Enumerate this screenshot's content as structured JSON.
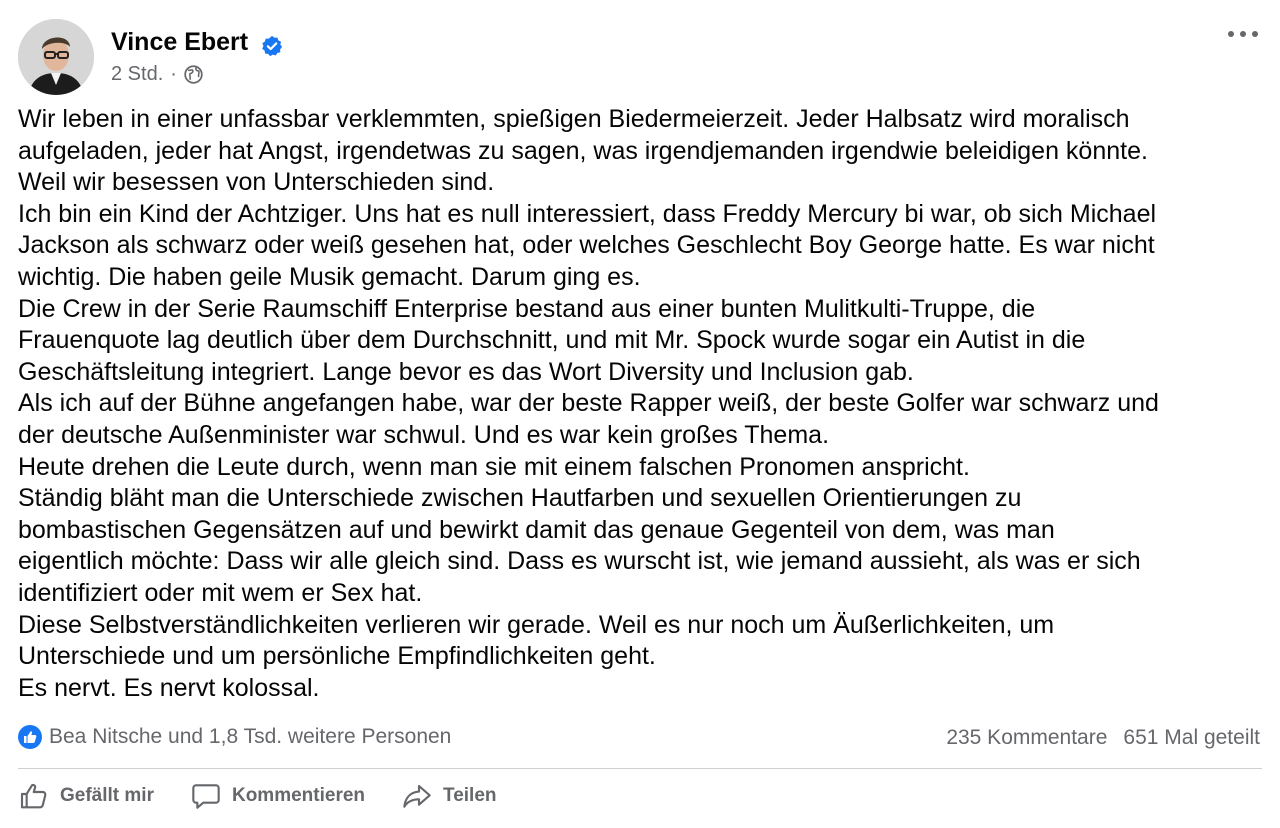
{
  "post": {
    "author": "Vince Ebert",
    "time": "2 Std.",
    "separator": "·",
    "icons": {
      "verified": "verified-badge-icon",
      "audience": "globe-icon",
      "menu": "more-options-icon"
    },
    "lines": [
      "Wir leben in einer unfassbar verklemmten, spießigen Biedermeierzeit. Jeder Halbsatz wird moralisch",
      "aufgeladen, jeder hat Angst, irgendetwas zu sagen, was irgendjemanden irgendwie beleidigen könnte.",
      "Weil wir besessen von Unterschieden sind.",
      "Ich bin ein Kind der Achtziger. Uns hat es null interessiert, dass Freddy Mercury bi war, ob sich Michael",
      "Jackson als schwarz oder weiß gesehen hat, oder welches Geschlecht Boy George hatte. Es war nicht",
      "wichtig. Die haben geile Musik gemacht. Darum ging es.",
      "Die Crew in der Serie Raumschiff Enterprise bestand aus einer bunten Mulitkulti-Truppe, die",
      "Frauenquote lag deutlich über dem Durchschnitt, und mit Mr. Spock wurde sogar ein Autist in die",
      "Geschäftsleitung integriert. Lange bevor es das Wort Diversity und Inclusion gab.",
      "Als ich auf der Bühne angefangen habe, war der beste Rapper weiß, der beste Golfer war schwarz und",
      "der deutsche Außenminister war schwul. Und es war kein großes Thema.",
      "Heute drehen die Leute durch, wenn man sie mit einem falschen Pronomen anspricht.",
      "Ständig bläht man die Unterschiede zwischen Hautfarben und sexuellen Orientierungen zu",
      "bombastischen Gegensätzen auf und bewirkt damit das genaue Gegenteil von dem, was man",
      "eigentlich möchte: Dass wir alle gleich sind. Dass es wurscht ist, wie jemand aussieht, als was er sich",
      "identifiziert oder mit wem er Sex hat.",
      "Diese Selbstverständlichkeiten verlieren wir gerade. Weil es nur noch um Äußerlichkeiten, um",
      "Unterschiede und um persönliche Empfindlichkeiten geht.",
      "Es nervt. Es nervt kolossal."
    ]
  },
  "stats": {
    "reactions": "Bea Nitsche und 1,8 Tsd. weitere Personen",
    "comments": "235 Kommentare",
    "shares": "651 Mal geteilt"
  },
  "actions": {
    "like": "Gefällt mir",
    "comment": "Kommentieren",
    "share": "Teilen"
  },
  "colors": {
    "accent": "#1877f2",
    "secondary_text": "#65676b",
    "divider": "#ced0d4"
  }
}
